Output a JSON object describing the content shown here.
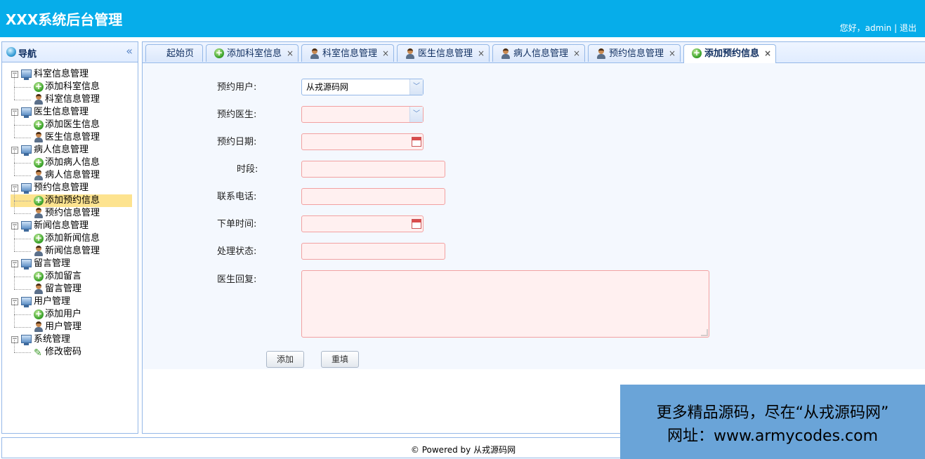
{
  "header": {
    "title": "XXX系统后台管理",
    "greeting": "您好，admin",
    "separator": "|",
    "logout": "退出"
  },
  "sidebar": {
    "title": "导航",
    "collapse_glyph": "«",
    "groups": [
      {
        "label": "科室信息管理",
        "items": [
          {
            "label": "添加科室信息",
            "icon": "add-icon"
          },
          {
            "label": "科室信息管理",
            "icon": "user-icon"
          }
        ]
      },
      {
        "label": "医生信息管理",
        "items": [
          {
            "label": "添加医生信息",
            "icon": "add-icon"
          },
          {
            "label": "医生信息管理",
            "icon": "user-icon"
          }
        ]
      },
      {
        "label": "病人信息管理",
        "items": [
          {
            "label": "添加病人信息",
            "icon": "add-icon"
          },
          {
            "label": "病人信息管理",
            "icon": "user-icon"
          }
        ]
      },
      {
        "label": "预约信息管理",
        "items": [
          {
            "label": "添加预约信息",
            "icon": "add-icon",
            "selected": true
          },
          {
            "label": "预约信息管理",
            "icon": "user-icon"
          }
        ]
      },
      {
        "label": "新闻信息管理",
        "items": [
          {
            "label": "添加新闻信息",
            "icon": "add-icon"
          },
          {
            "label": "新闻信息管理",
            "icon": "user-icon"
          }
        ]
      },
      {
        "label": "留言管理",
        "items": [
          {
            "label": "添加留言",
            "icon": "add-icon"
          },
          {
            "label": "留言管理",
            "icon": "user-icon"
          }
        ]
      },
      {
        "label": "用户管理",
        "items": [
          {
            "label": "添加用户",
            "icon": "add-icon"
          },
          {
            "label": "用户管理",
            "icon": "user-icon"
          }
        ]
      },
      {
        "label": "系统管理",
        "items": [
          {
            "label": "修改密码",
            "icon": "pencil-icon"
          }
        ]
      }
    ]
  },
  "tabs": [
    {
      "label": "起始页",
      "icon": "",
      "closable": false
    },
    {
      "label": "添加科室信息",
      "icon": "add-icon",
      "closable": true
    },
    {
      "label": "科室信息管理",
      "icon": "user-icon",
      "closable": true
    },
    {
      "label": "医生信息管理",
      "icon": "user-icon",
      "closable": true
    },
    {
      "label": "病人信息管理",
      "icon": "user-icon",
      "closable": true
    },
    {
      "label": "预约信息管理",
      "icon": "user-icon",
      "closable": true
    },
    {
      "label": "添加预约信息",
      "icon": "add-icon",
      "closable": true,
      "active": true
    }
  ],
  "tab_close_glyph": "×",
  "form": {
    "user_label": "预约用户:",
    "user_value": "从戎源码网",
    "doctor_label": "预约医生:",
    "doctor_value": "",
    "date_label": "预约日期:",
    "date_value": "",
    "period_label": "时段:",
    "period_value": "",
    "phone_label": "联系电话:",
    "phone_value": "",
    "order_time_label": "下单时间:",
    "order_time_value": "",
    "status_label": "处理状态:",
    "status_value": "",
    "reply_label": "医生回复:",
    "reply_value": "",
    "submit_label": "添加",
    "reset_label": "重填"
  },
  "footer": {
    "copyright": "© Powered by 从戎源码网"
  },
  "promo": {
    "line1": "更多精品源码，尽在“从戎源码网”",
    "line2": "网址：www.armycodes.com"
  },
  "colors": {
    "header_bg": "#06adea",
    "panel_border": "#95b8e7",
    "invalid_field_bg": "#fff0f0",
    "invalid_field_border": "#f2a1a1",
    "selected_item_bg": "#fde38f",
    "promo_bg": "#6aa4d8"
  }
}
